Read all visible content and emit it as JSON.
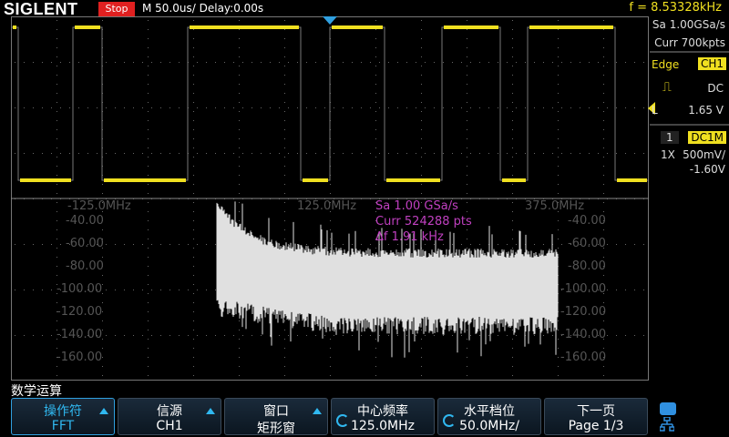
{
  "top": {
    "logo": "SIGLENT",
    "run_status": "Stop",
    "timebase": "M 50.0us/",
    "delay": "Delay:0.00s",
    "frequency": "f = 8.53328kHz"
  },
  "acquisition": {
    "sample_rate": "Sa 1.00GSa/s",
    "memory": "Curr 700kpts"
  },
  "trigger": {
    "type": "Edge",
    "source": "CH1",
    "edge_icon": "rising-edge-icon",
    "coupling": "DC",
    "level_label": "L",
    "level": "1.65 V"
  },
  "channel": {
    "number": "1",
    "coupling": "DC1M",
    "probe": "1X",
    "scale": "500mV/",
    "offset": "-1.60V",
    "marker_label": "1",
    "color": "#f0e020"
  },
  "fft": {
    "info_sa": "Sa 1.00 GSa/s",
    "info_curr": "Curr 524288 pts",
    "info_df": "Δf 1.91 kHz",
    "info_color": "#c040c0",
    "x_labels": [
      "-125.0MHz",
      "125.0MHz",
      "375.0MHz"
    ],
    "y_labels": [
      "-40.00",
      "-60.00",
      "-80.00",
      "-100.00",
      "-120.00",
      "-140.00",
      "-160.00"
    ]
  },
  "menu": {
    "title": "数学运算",
    "softkeys": [
      {
        "line1": "操作符",
        "line2": "FFT",
        "arrow": true,
        "knob": false,
        "active": true
      },
      {
        "line1": "信源",
        "line2": "CH1",
        "arrow": true,
        "knob": false,
        "active": false
      },
      {
        "line1": "窗口",
        "line2": "矩形窗",
        "arrow": true,
        "knob": false,
        "active": false
      },
      {
        "line1": "中心频率",
        "line2": "125.0MHz",
        "arrow": false,
        "knob": true,
        "active": false
      },
      {
        "line1": "水平档位",
        "line2": "50.0MHz/",
        "arrow": false,
        "knob": true,
        "active": false
      },
      {
        "line1": "下一页",
        "line2": "Page 1/3",
        "arrow": false,
        "knob": false,
        "active": false
      }
    ]
  },
  "colors": {
    "trace": "#f0e020",
    "fft_trace": "#e0e0e0",
    "grid": "#6a6a6a",
    "accent": "#30b8f0",
    "stop": "#e02020"
  }
}
